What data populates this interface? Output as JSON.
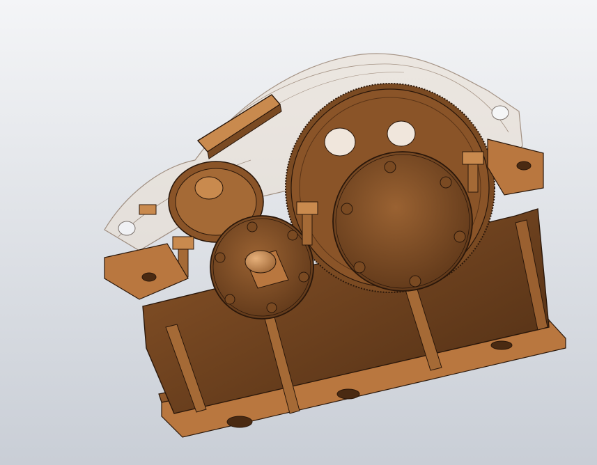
{
  "viewport": {
    "background_top": "#f4f5f7",
    "background_bottom": "#c9ced6"
  },
  "model": {
    "body_color": "#7a4a22",
    "body_dark": "#4a2a12",
    "highlight_color": "#c98a4e",
    "edge_color": "#2a170a",
    "cover_color": "#eadfd2"
  }
}
